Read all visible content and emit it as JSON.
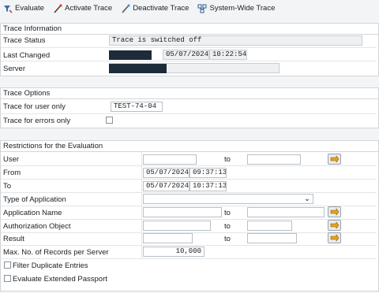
{
  "toolbar": {
    "evaluate": "Evaluate",
    "activate": "Activate Trace",
    "deactivate": "Deactivate Trace",
    "system_wide": "System-Wide Trace"
  },
  "trace_info": {
    "title": "Trace Information",
    "status_label": "Trace Status",
    "status_value": "Trace is switched off",
    "changed_label": "Last Changed",
    "changed_date": "05/07/2024",
    "changed_time": "10:22:54",
    "server_label": "Server"
  },
  "trace_options": {
    "title": "Trace Options",
    "user_only_label": "Trace for user only",
    "user_only_value": "TEST-74-04",
    "errors_only_label": "Trace for errors only"
  },
  "restrictions": {
    "title": "Restrictions for the Evaluation",
    "user_label": "User",
    "to_label": "to",
    "from_label": "From",
    "from_date": "05/07/2024",
    "from_time": "09:37:13",
    "to_row_label": "To",
    "to_date": "05/07/2024",
    "to_time": "10:37:13",
    "type_app_label": "Type of Application",
    "app_name_label": "Application Name",
    "auth_obj_label": "Authorization Object",
    "result_label": "Result",
    "max_records_label": "Max. No. of Records per Server",
    "max_records_value": "10,000",
    "filter_dup_label": "Filter Duplicate Entries",
    "eval_ext_label": "Evaluate Extended Passport"
  },
  "colors": {
    "accent": "#e8a317",
    "masked": "#1d2b3a"
  }
}
